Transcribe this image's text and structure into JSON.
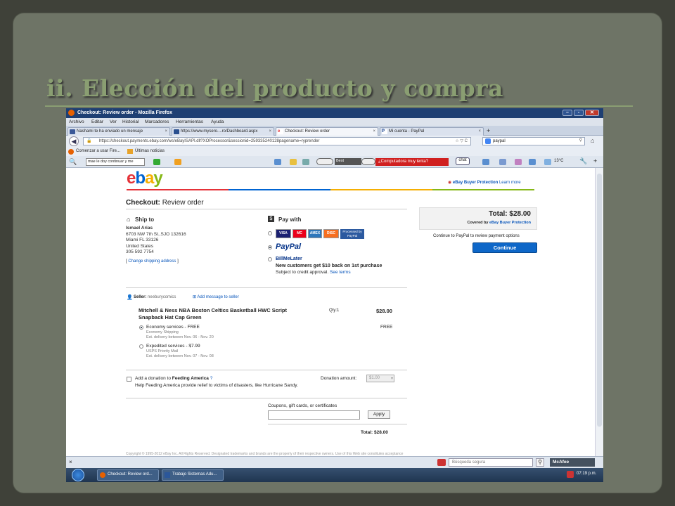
{
  "slide": {
    "title": "ii. Elección del producto y compra"
  },
  "browser": {
    "window_title": "Checkout: Review order - Mozilla Firefox",
    "menu": [
      "Archivo",
      "Editar",
      "Ver",
      "Historial",
      "Marcadores",
      "Herramientas",
      "Ayuda"
    ],
    "tabs": [
      {
        "label": "Nashami te ha enviado un mensaje",
        "active": false
      },
      {
        "label": "https://www.mysero....ro/Dashboard.aspx",
        "active": false
      },
      {
        "label": "Checkout: Review order",
        "active": true
      },
      {
        "label": "Mi cuenta - PayPal",
        "active": false
      }
    ],
    "url": "https://checkout.payments.ebay.com/ws/eBayISAPI.dll?XOProcessor&sessionid=259335240128pagename=ryprender",
    "search_value": "paypal",
    "bookmarks": [
      "Comenzar a usar Fire...",
      "Últimas noticias"
    ],
    "toolbar_input": "mae le doy continuar y me",
    "toolbar_best": "Best",
    "toolbar_ad": "¿Computadora muy lenta?",
    "toolbar_chat": "chat",
    "toolbar_temp": "13°C",
    "status_search_placeholder": "Búsqueda segura",
    "mcafee": "McAfee"
  },
  "checkout": {
    "logo": [
      "e",
      "b",
      "a",
      "y"
    ],
    "buyer_protection": "eBay Buyer Protection",
    "learn_more": "Learn more",
    "heading_bold": "Checkout:",
    "heading_rest": "Review order",
    "ship_to": "Ship to",
    "address": [
      "Ismael Arias",
      "6703 NW 7th St.,SJO 132616",
      "Miami FL 33126",
      "United States",
      "305 592 7754"
    ],
    "change_shipping": "Change shipping address",
    "pay_with": "Pay with",
    "cards": [
      "VISA",
      "MC",
      "AMEX",
      "DISC"
    ],
    "processed_by": "Processed by PayPal",
    "paypal": "PayPal",
    "billmelater": "BillMeLater",
    "bml_promo": "New customers get $10 back on 1st purchase",
    "bml_sub": "Subject to credit approval.",
    "see_terms": "See terms",
    "seller_label": "Seller:",
    "seller_name": "neeburycomics",
    "add_message": "Add message to seller",
    "item_title": "Mitchell & Ness NBA Boston Celtics Basketball HWC Script Snapback Hat Cap Green",
    "qty": "Qty:1",
    "item_price": "$28.00",
    "economy_label": "Economy services - FREE",
    "economy_sub": "Economy Shipping",
    "economy_delivery": "Est. delivery between Nov. 06 - Nov. 20",
    "economy_price": "FREE",
    "expedited_label": "Expedited services - $7.99",
    "expedited_sub": "USPS Priority Mail",
    "expedited_delivery": "Est. delivery between Nov. 07 - Nov. 08",
    "donation_pre": "Add a donation to",
    "donation_org": "Feeding America",
    "donation_sub": "Help Feeding America provide relief to victims of disasters, like Hurricane Sandy.",
    "donation_amount_label": "Donation amount:",
    "donation_amount": "$1.00",
    "coupons_label": "Coupons, gift cards, or certificates",
    "apply": "Apply",
    "total_label": "Total:",
    "total_value": "$28.00",
    "summary_total": "Total: $28.00",
    "covered_by": "Covered by",
    "covered_link": "eBay Buyer Protection",
    "continue_note": "Continue to PayPal to review payment options",
    "continue_btn": "Continue",
    "footer": "Copyright © 1995-2012 eBay Inc. All Rights Reserved. Designated trademarks and brands are the property of their respective owners. Use of this Web site constitutes acceptance"
  },
  "taskbar": {
    "items": [
      "Checkout: Review ord...",
      "Trabajo Sistemas Adu..."
    ],
    "clock": "07:19 p.m."
  }
}
